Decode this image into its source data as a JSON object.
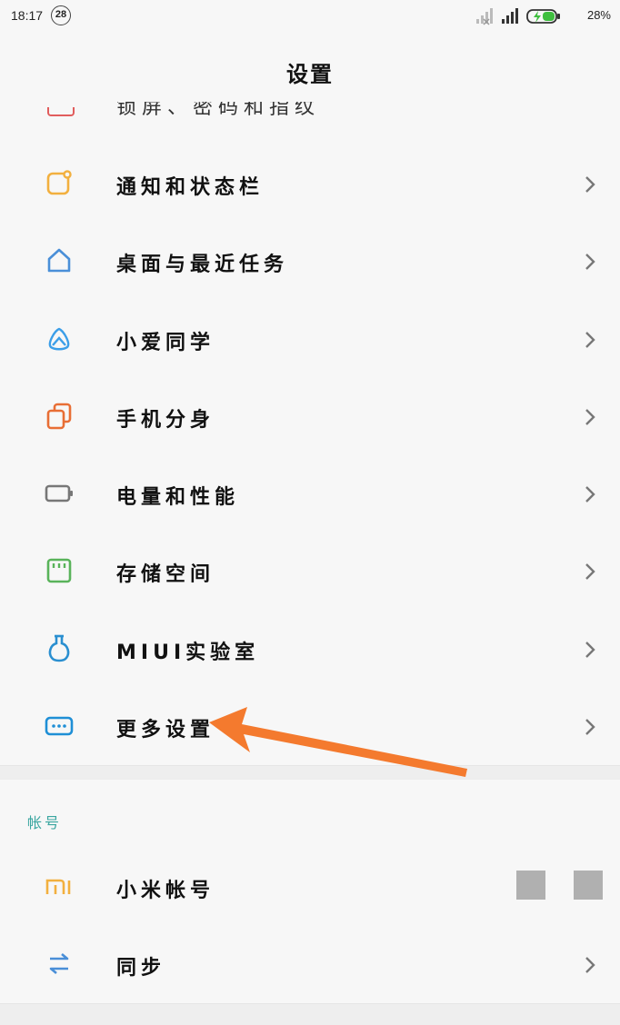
{
  "status_bar": {
    "time": "18:17",
    "notification_count": "28",
    "battery_percent": "28%"
  },
  "title": "设置",
  "partial_row_label": "锁屏、密码和指纹",
  "items": [
    {
      "label": "通知和状态栏",
      "icon": "notification-icon",
      "color": "#f2b03f"
    },
    {
      "label": "桌面与最近任务",
      "icon": "home-icon",
      "color": "#4a8fd8"
    },
    {
      "label": "小爱同学",
      "icon": "xiaoai-icon",
      "color": "#3b9ee8"
    },
    {
      "label": "手机分身",
      "icon": "dual-phone-icon",
      "color": "#e86e35"
    },
    {
      "label": "电量和性能",
      "icon": "battery-icon",
      "color": "#777777"
    },
    {
      "label": "存储空间",
      "icon": "storage-icon",
      "color": "#59b35a"
    },
    {
      "label": "MIUI实验室",
      "icon": "lab-flask-icon",
      "color": "#2a8fd0"
    },
    {
      "label": "更多设置",
      "icon": "more-settings-icon",
      "color": "#1f8fd6"
    }
  ],
  "account_section": {
    "header": "帐号",
    "items": [
      {
        "label": "小米帐号",
        "icon": "mi-logo-icon",
        "color": "#f2b03f"
      },
      {
        "label": "同步",
        "icon": "sync-icon",
        "color": "#4a8fd8"
      }
    ]
  },
  "annotation_color": "#f47a2e"
}
